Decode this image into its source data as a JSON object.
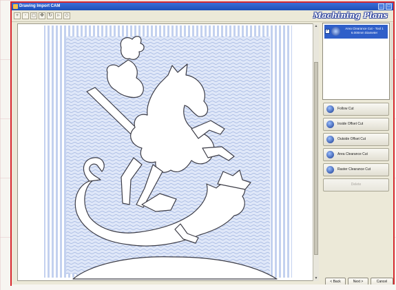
{
  "window": {
    "title": "Drawing Import CAM",
    "brand": "Machining Plans",
    "controls": [
      "_",
      "□"
    ]
  },
  "toolbar": {
    "tools": [
      {
        "icon": "zoom-in-icon",
        "glyph": "+"
      },
      {
        "icon": "zoom-out-icon",
        "glyph": "-"
      },
      {
        "icon": "zoom-fit-icon",
        "glyph": "◻"
      },
      {
        "icon": "pan-icon",
        "glyph": "✥"
      },
      {
        "icon": "rotate-icon",
        "glyph": "↻"
      },
      {
        "icon": "select-icon",
        "glyph": "▹"
      },
      {
        "icon": "settings-icon",
        "glyph": "◇"
      }
    ]
  },
  "plans": {
    "items": [
      {
        "label": "Area Clearance Cut - Tool 1",
        "detail": "6.000mm Diameter",
        "checked": true,
        "selected": true
      }
    ]
  },
  "operations": [
    {
      "label": "Follow Cut",
      "icon": "follow-cut-icon",
      "enabled": true
    },
    {
      "label": "Inside Offset Cut",
      "icon": "inside-offset-icon",
      "enabled": true
    },
    {
      "label": "Outside Offset Cut",
      "icon": "outside-offset-icon",
      "enabled": true
    },
    {
      "label": "Area Clearance Cut",
      "icon": "area-clearance-icon",
      "enabled": true
    },
    {
      "label": "Raster Clearance Cut",
      "icon": "raster-clearance-icon",
      "enabled": true
    },
    {
      "label": "Delete",
      "icon": "",
      "enabled": false
    }
  ],
  "navigation": {
    "back": "< Back",
    "next": "Next >",
    "cancel": "Cancel"
  },
  "colors": {
    "accent": "#2f5fc9",
    "frame": "#d8262c",
    "toolpath": "#b9c9ee"
  }
}
